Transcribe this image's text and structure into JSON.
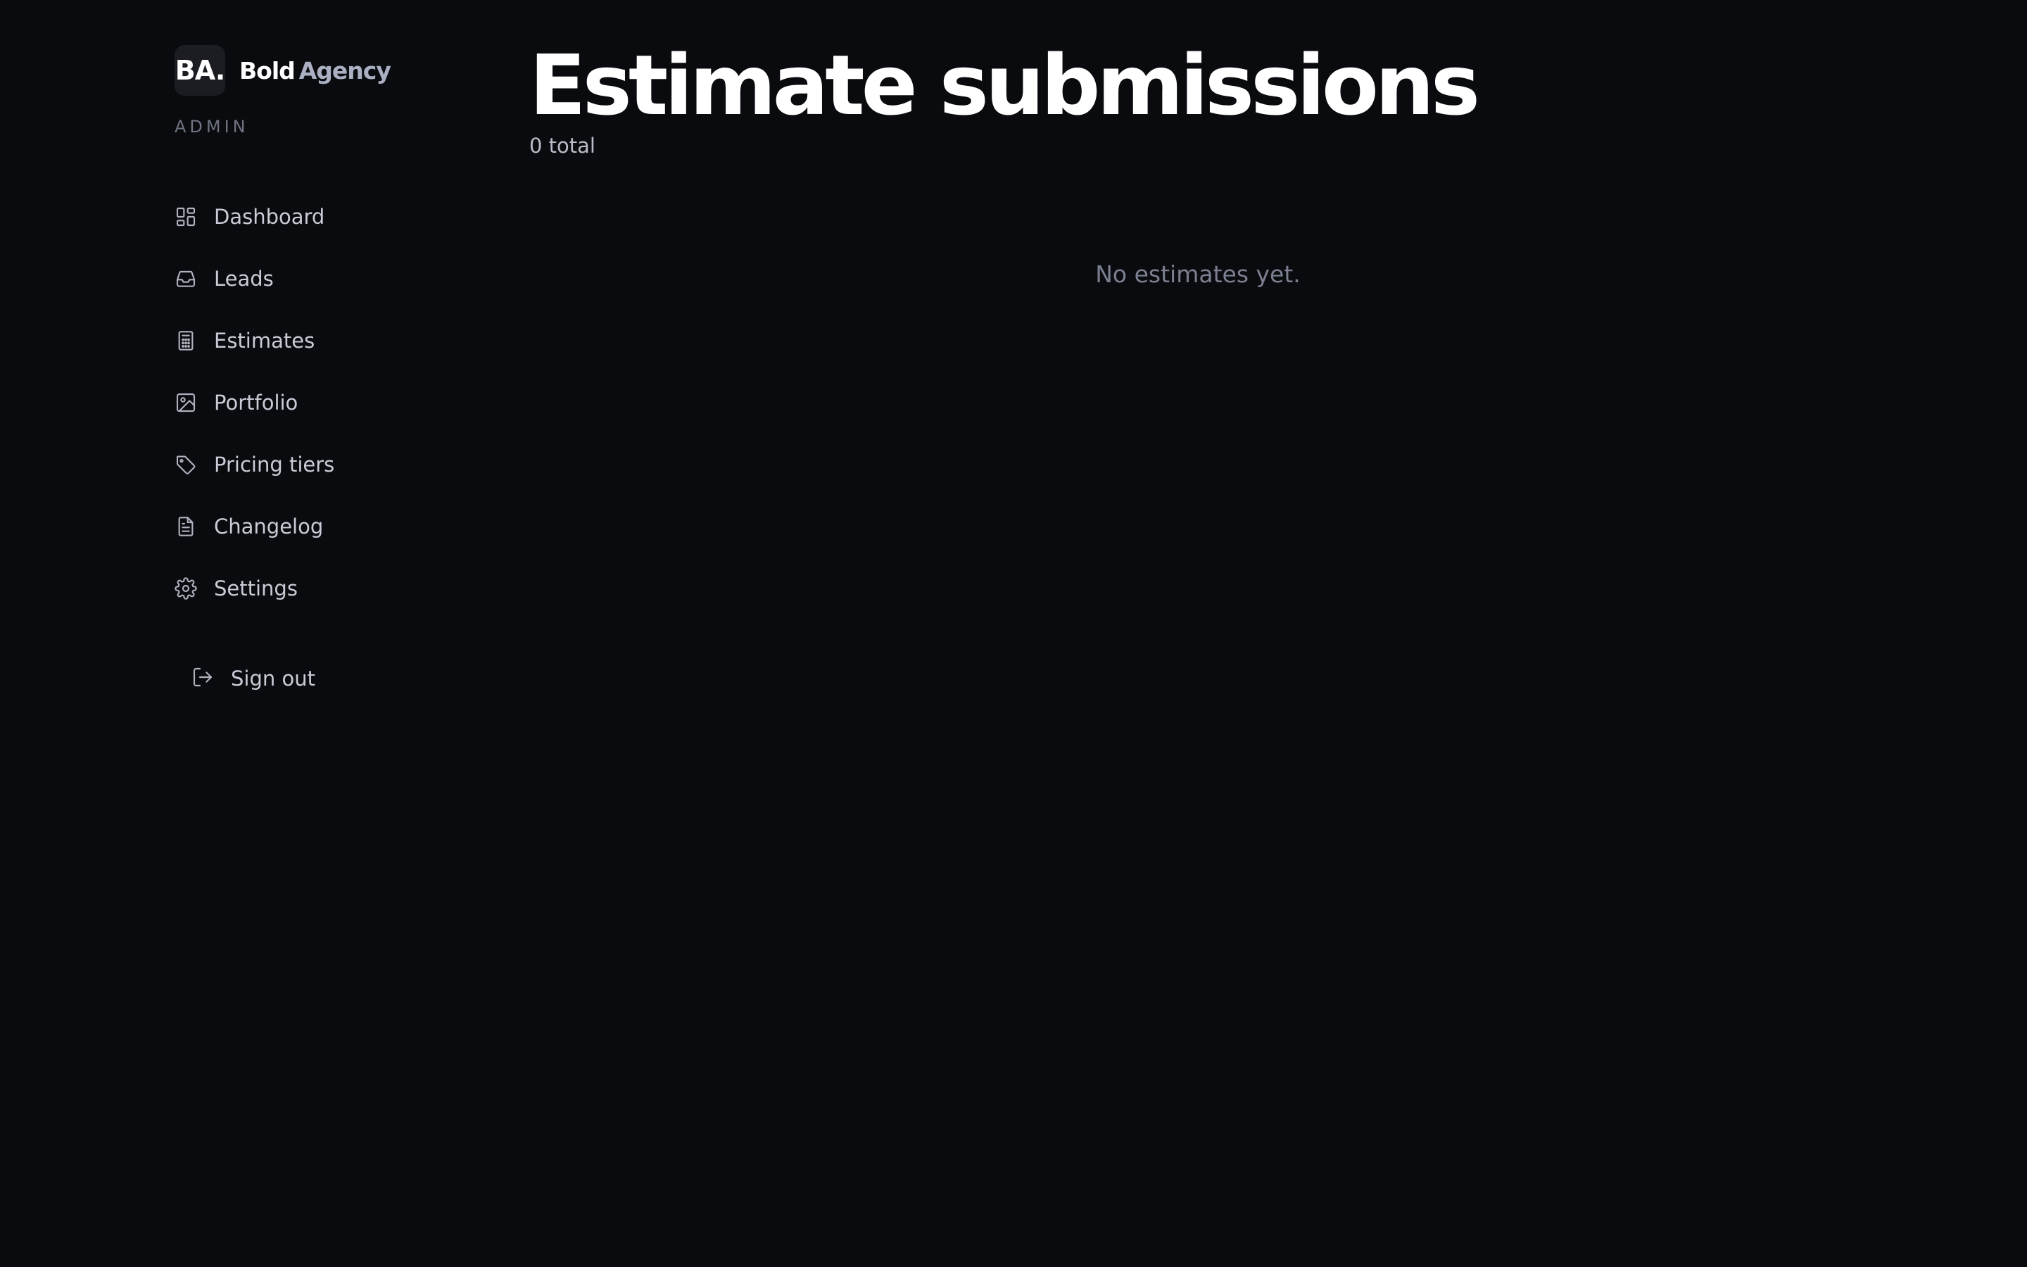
{
  "brand": {
    "mark": "BA.",
    "name_bold": "Bold",
    "name_light": "Agency",
    "role_label": "ADMIN"
  },
  "sidebar": {
    "items": [
      {
        "label": "Dashboard",
        "icon": "dashboard-icon"
      },
      {
        "label": "Leads",
        "icon": "inbox-icon"
      },
      {
        "label": "Estimates",
        "icon": "calculator-icon"
      },
      {
        "label": "Portfolio",
        "icon": "image-icon"
      },
      {
        "label": "Pricing tiers",
        "icon": "tag-icon"
      },
      {
        "label": "Changelog",
        "icon": "document-icon"
      },
      {
        "label": "Settings",
        "icon": "gear-icon"
      }
    ],
    "signout": {
      "label": "Sign out",
      "icon": "sign-out-icon"
    }
  },
  "main": {
    "title": "Estimate submissions",
    "total": "0 total",
    "empty_message": "No estimates yet."
  },
  "colors": {
    "background": "#0a0b0f",
    "text_primary": "#ffffff",
    "text_muted": "#7b8090"
  }
}
